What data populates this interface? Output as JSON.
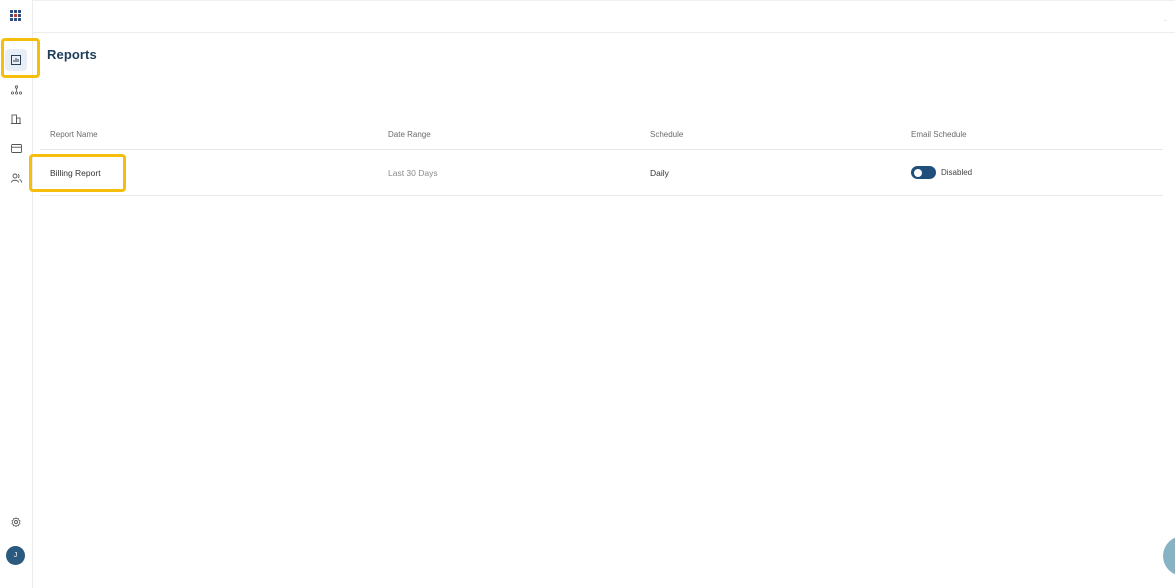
{
  "sidebar": {
    "apps_icon": "apps-grid-icon",
    "items": [
      {
        "icon": "reports-icon",
        "active": true
      },
      {
        "icon": "hierarchy-icon"
      },
      {
        "icon": "building-icon"
      },
      {
        "icon": "credit-card-icon"
      },
      {
        "icon": "users-icon"
      }
    ],
    "settings_icon": "gear-icon",
    "avatar_initial": "J"
  },
  "topbar": {
    "menu_dots": ".."
  },
  "page": {
    "title": "Reports"
  },
  "table": {
    "headers": {
      "report_name": "Report Name",
      "date_range": "Date Range",
      "schedule": "Schedule",
      "email_schedule": "Email Schedule"
    },
    "rows": [
      {
        "report_name": "Billing Report",
        "date_range": "Last 30 Days",
        "schedule": "Daily",
        "email_schedule_status": "Disabled"
      }
    ]
  },
  "colors": {
    "accent": "#1f4f7a",
    "highlight": "#f5bd0c",
    "title": "#1f3e5a"
  }
}
